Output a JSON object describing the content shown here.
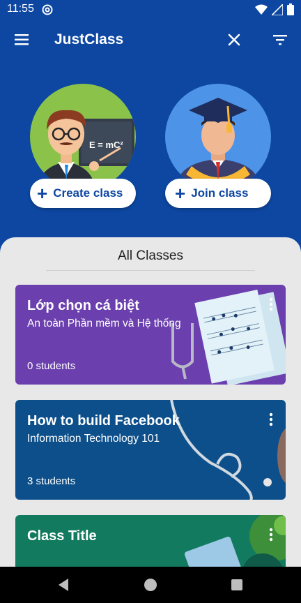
{
  "status_bar": {
    "time": "11:55"
  },
  "app_bar": {
    "title": "JustClass"
  },
  "hero": {
    "create_label": "Create class",
    "join_label": "Join class",
    "board_text": "E = mC²"
  },
  "section": {
    "title": "All Classes"
  },
  "classes": [
    {
      "title": "Lớp chọn cá biệt",
      "subtitle": "An toàn Phần mềm và Hệ thống",
      "students": "0 students",
      "color": "#6b3fae"
    },
    {
      "title": "How to build Facebook",
      "subtitle": "Information Technology 101",
      "students": "3 students",
      "color": "#0c4f8a"
    },
    {
      "title": "Class Title",
      "subtitle": "",
      "students": "",
      "color": "#127a5e"
    }
  ],
  "colors": {
    "primary": "#0d47a1",
    "sheet": "#e8e8e8"
  }
}
